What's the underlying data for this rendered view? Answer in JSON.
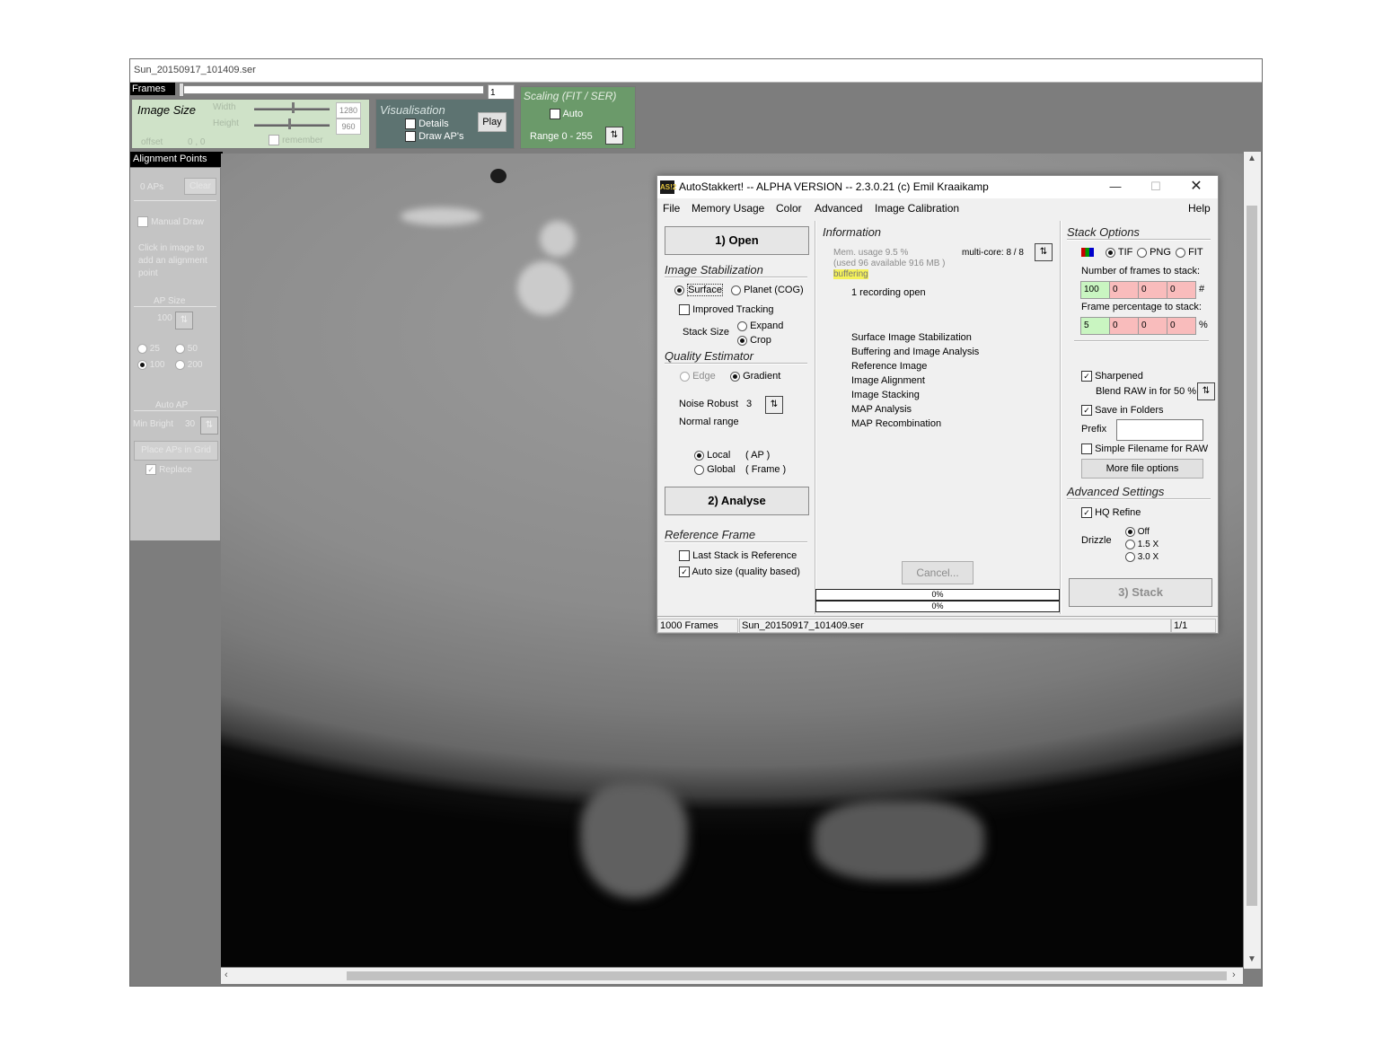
{
  "viewer": {
    "title": "Sun_20150917_101409.ser",
    "frames_label": "Frames",
    "frame_value": "1",
    "image_size": {
      "title": "Image Size",
      "width_label": "Width",
      "height_label": "Height",
      "width_value": "1280",
      "height_value": "960",
      "offset_label": "offset",
      "offset_value": "0 , 0",
      "remember_label": "remember"
    },
    "visualisation": {
      "title": "Visualisation",
      "details_label": "Details",
      "draw_aps_label": "Draw AP's",
      "play_label": "Play"
    },
    "scaling": {
      "title": "Scaling (FIT / SER)",
      "auto_label": "Auto",
      "range_label": "Range 0 - 255"
    },
    "alignment_points": {
      "header": "Alignment Points",
      "count_label": "0 APs",
      "clear_label": "Clear",
      "manual_draw_label": "Manual Draw",
      "hint": "Click in image to add an alignment point",
      "ap_size_label": "AP Size",
      "ap_size_value": "100",
      "size_options": [
        "25",
        "50",
        "100",
        "200"
      ],
      "auto_ap_label": "Auto AP",
      "min_bright_label": "Min Bright",
      "min_bright_value": "30",
      "place_grid_label": "Place APs in Grid",
      "replace_label": "Replace"
    }
  },
  "autostakkert": {
    "logo": "AS!2",
    "title": "AutoStakkert! -- ALPHA VERSION -- 2.3.0.21  (c) Emil Kraaikamp",
    "menu": [
      "File",
      "Memory Usage",
      "Color",
      "Advanced",
      "Image Calibration"
    ],
    "help": "Help",
    "open_button": "1) Open",
    "image_stabilization": {
      "title": "Image Stabilization",
      "surface_label": "Surface",
      "planet_label": "Planet (COG)",
      "improved_tracking_label": "Improved Tracking",
      "stack_size_label": "Stack Size",
      "expand_label": "Expand",
      "crop_label": "Crop"
    },
    "quality_estimator": {
      "title": "Quality Estimator",
      "edge_label": "Edge",
      "gradient_label": "Gradient",
      "noise_robust_label": "Noise Robust",
      "noise_robust_value": "3",
      "normal_range_label": "Normal range",
      "local_label": "Local",
      "local_sub": "( AP )",
      "global_label": "Global",
      "global_sub": "( Frame )"
    },
    "analyse_button": "2) Analyse",
    "reference_frame": {
      "title": "Reference Frame",
      "last_stack_label": "Last Stack is Reference",
      "auto_size_label": "Auto size (quality based)"
    },
    "information": {
      "title": "Information",
      "mem_usage": "Mem. usage 9.5 %",
      "mem_detail": "(used 96 available 916 MB )",
      "buffering": "buffering",
      "multicore": "multi-core: 8 / 8",
      "recording": "1 recording open",
      "steps": [
        "Surface Image Stabilization",
        "Buffering and Image Analysis",
        "Reference Image",
        "Image Alignment",
        "Image Stacking",
        "MAP Analysis",
        "MAP Recombination"
      ],
      "cancel_label": "Cancel...",
      "progress1": "0%",
      "progress2": "0%"
    },
    "stack_options": {
      "title": "Stack Options",
      "tif_label": "TIF",
      "png_label": "PNG",
      "fit_label": "FIT",
      "frames_to_stack_label": "Number of frames to stack:",
      "frames_values": [
        "100",
        "0",
        "0",
        "0"
      ],
      "frames_suffix": "#",
      "percentage_label": "Frame percentage to stack:",
      "percentage_values": [
        "5",
        "0",
        "0",
        "0"
      ],
      "percentage_suffix": "%",
      "sharpened_label": "Sharpened",
      "blend_label": "Blend RAW in for 50 %",
      "save_in_folders_label": "Save in Folders",
      "prefix_label": "Prefix",
      "prefix_value": "",
      "simple_filename_label": "Simple Filename for RAW",
      "more_options_label": "More file options"
    },
    "advanced_settings": {
      "title": "Advanced Settings",
      "hq_refine_label": "HQ Refine",
      "drizzle_label": "Drizzle",
      "drizzle_options": [
        "Off",
        "1.5 X",
        "3.0 X"
      ]
    },
    "stack_button": "3) Stack",
    "status": {
      "frames": "1000 Frames",
      "file": "Sun_20150917_101409.ser",
      "page": "1/1"
    }
  }
}
